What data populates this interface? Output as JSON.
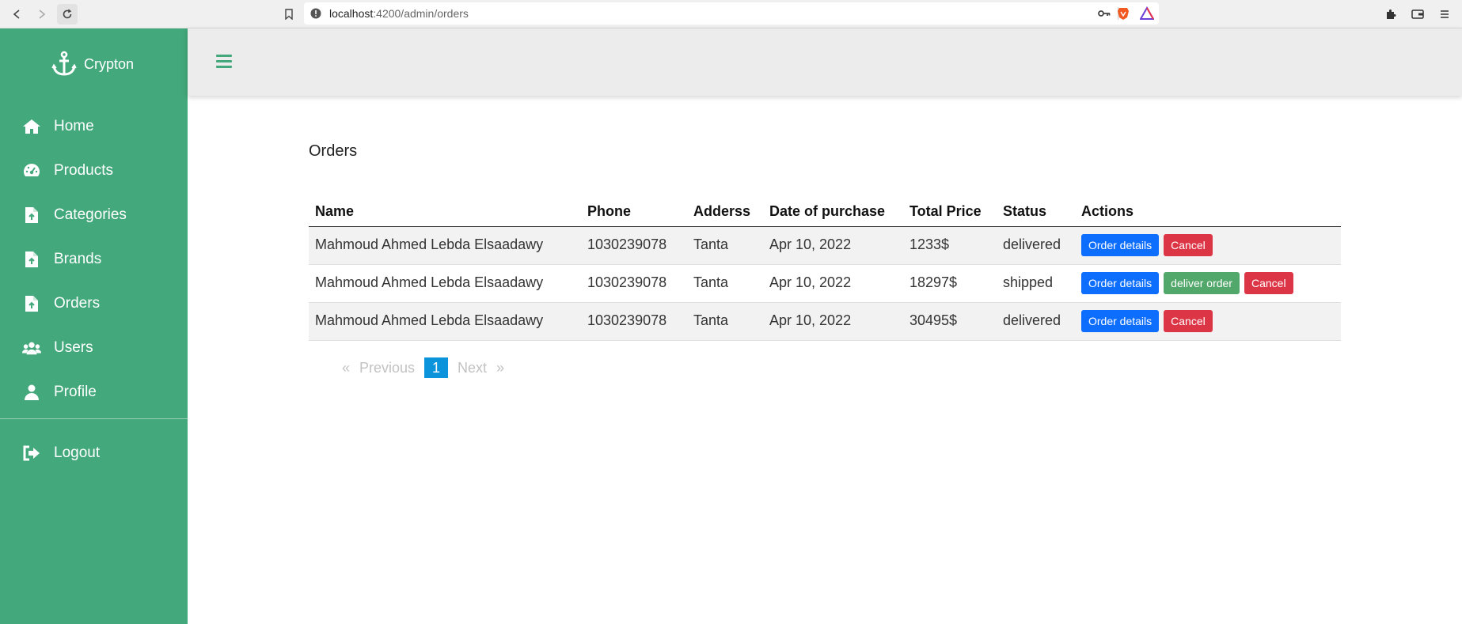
{
  "browser": {
    "url_host": "localhost",
    "url_path": ":4200/admin/orders",
    "icons": [
      "back-icon",
      "forward-icon",
      "reload-icon",
      "bookmark-icon",
      "info-icon",
      "key-icon",
      "brave-lion-icon",
      "rewards-triangle-icon",
      "extensions-icon",
      "wallet-icon",
      "menu-icon"
    ]
  },
  "colors": {
    "sidebar": "#43a87b",
    "primary": "#0d6efd",
    "danger": "#dc3545",
    "success": "#52a86b",
    "pager_active": "#0b93db"
  },
  "sidebar": {
    "brand": "Crypton",
    "items": [
      {
        "label": "Home",
        "icon": "home-icon"
      },
      {
        "label": "Products",
        "icon": "gauge-icon"
      },
      {
        "label": "Categories",
        "icon": "file-upload-icon"
      },
      {
        "label": "Brands",
        "icon": "file-upload-icon"
      },
      {
        "label": "Orders",
        "icon": "file-upload-icon"
      },
      {
        "label": "Users",
        "icon": "users-icon"
      },
      {
        "label": "Profile",
        "icon": "user-icon"
      }
    ],
    "logout": "Logout"
  },
  "main": {
    "title": "Orders",
    "columns": [
      "Name",
      "Phone",
      "Adderss",
      "Date of purchase",
      "Total Price",
      "Status",
      "Actions"
    ],
    "rows": [
      {
        "name": "Mahmoud Ahmed Lebda Elsaadawy",
        "phone": "1030239078",
        "address": "Tanta",
        "date": "Apr 10, 2022",
        "price": "1233$",
        "status": "delivered"
      },
      {
        "name": "Mahmoud Ahmed Lebda Elsaadawy",
        "phone": "1030239078",
        "address": "Tanta",
        "date": "Apr 10, 2022",
        "price": "18297$",
        "status": "shipped"
      },
      {
        "name": "Mahmoud Ahmed Lebda Elsaadawy",
        "phone": "1030239078",
        "address": "Tanta",
        "date": "Apr 10, 2022",
        "price": "30495$",
        "status": "delivered"
      }
    ],
    "actions": {
      "details": "Order details",
      "deliver": "deliver order",
      "cancel": "Cancel"
    },
    "pagination": {
      "prev_arrow": "«",
      "prev": "Previous",
      "current": "1",
      "next": "Next",
      "next_arrow": "»"
    }
  }
}
